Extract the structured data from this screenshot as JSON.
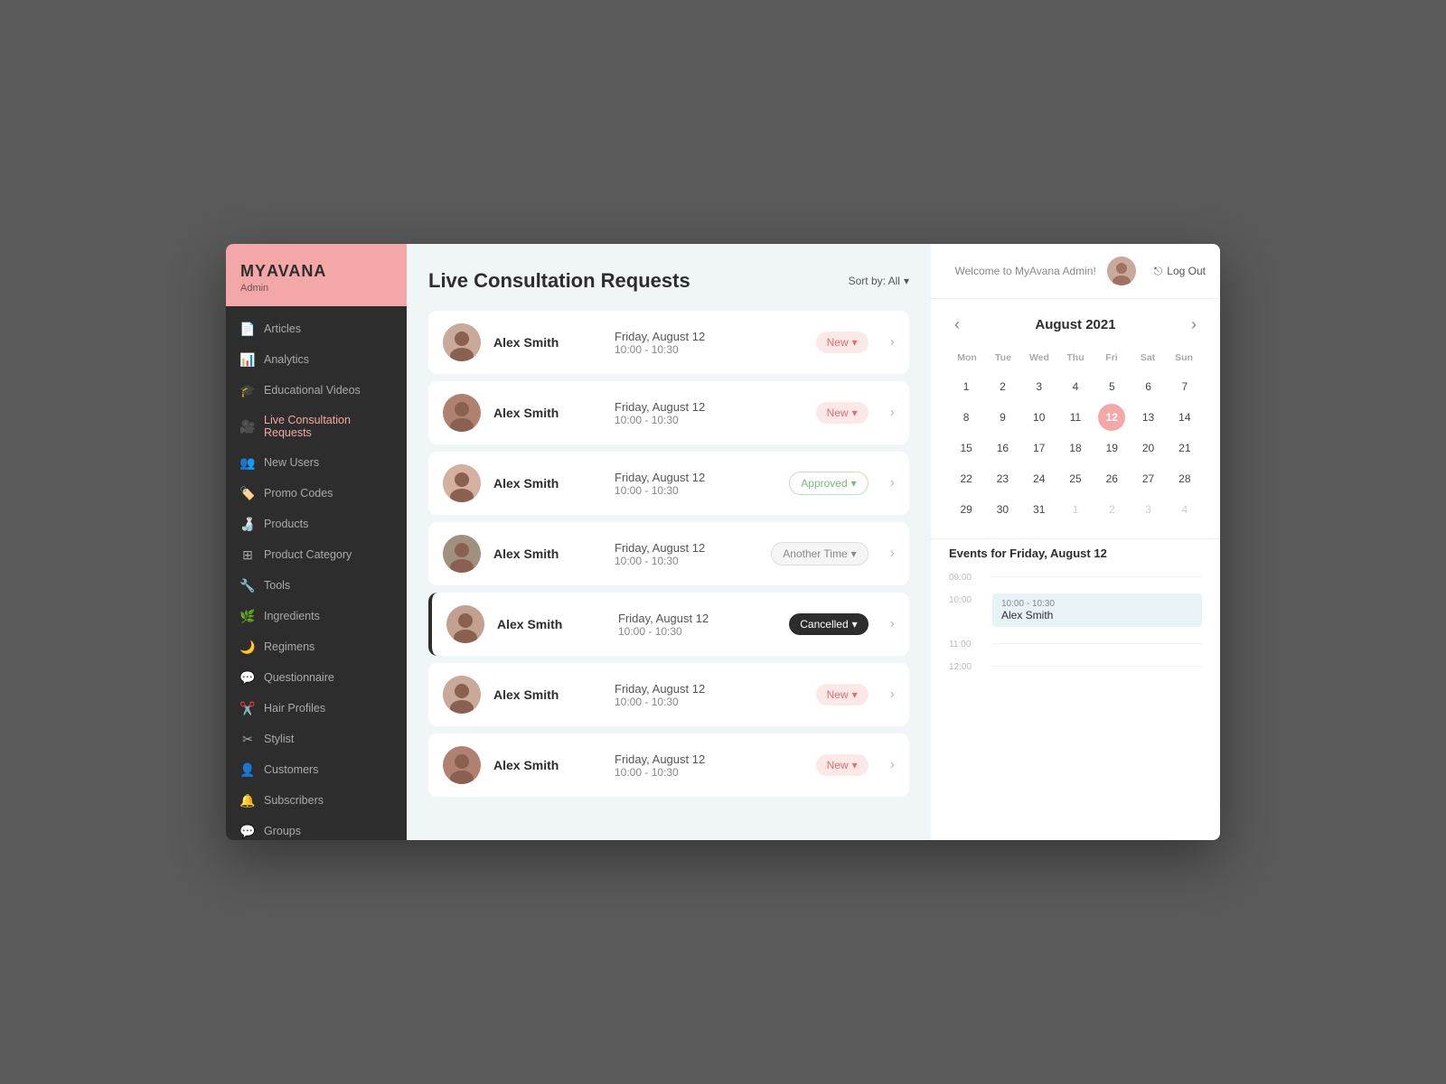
{
  "sidebar": {
    "logo": "MYAVANA",
    "logo_my": "MY",
    "logo_avana": "AVANA",
    "admin_label": "Admin",
    "nav_items": [
      {
        "id": "articles",
        "label": "Articles",
        "icon": "📄",
        "active": false
      },
      {
        "id": "analytics",
        "label": "Analytics",
        "icon": "📊",
        "active": false
      },
      {
        "id": "educational_videos",
        "label": "Educational Videos",
        "icon": "🎓",
        "active": false
      },
      {
        "id": "live_consultation",
        "label": "Live Consultation Requests",
        "icon": "🎥",
        "active": true
      },
      {
        "id": "new_users",
        "label": "New Users",
        "icon": "👥",
        "active": false
      },
      {
        "id": "promo_codes",
        "label": "Promo Codes",
        "icon": "🏷️",
        "active": false
      },
      {
        "id": "products",
        "label": "Products",
        "icon": "🍶",
        "active": false
      },
      {
        "id": "product_category",
        "label": "Product Category",
        "icon": "⊞",
        "active": false
      },
      {
        "id": "tools",
        "label": "Tools",
        "icon": "🔧",
        "active": false
      },
      {
        "id": "ingredients",
        "label": "Ingredients",
        "icon": "🌿",
        "active": false
      },
      {
        "id": "regimens",
        "label": "Regimens",
        "icon": "🌙",
        "active": false
      },
      {
        "id": "questionnaire",
        "label": "Questionnaire",
        "icon": "💬",
        "active": false
      },
      {
        "id": "hair_profiles",
        "label": "Hair Profiles",
        "icon": "✂️",
        "active": false
      },
      {
        "id": "stylist",
        "label": "Stylist",
        "icon": "✂",
        "active": false
      },
      {
        "id": "customers",
        "label": "Customers",
        "icon": "👤",
        "active": false
      },
      {
        "id": "subscribers",
        "label": "Subscribers",
        "icon": "🔔",
        "active": false
      },
      {
        "id": "groups",
        "label": "Groups",
        "icon": "💬",
        "active": false
      }
    ]
  },
  "main": {
    "page_title": "Live Consultation Requests",
    "sort_label": "Sort by: All",
    "consultations": [
      {
        "id": 1,
        "name": "Alex Smith",
        "date": "Friday, August 12",
        "time": "10:00 - 10:30",
        "status": "New",
        "status_type": "new",
        "cancelled": false
      },
      {
        "id": 2,
        "name": "Alex Smith",
        "date": "Friday, August 12",
        "time": "10:00 - 10:30",
        "status": "New",
        "status_type": "new",
        "cancelled": false
      },
      {
        "id": 3,
        "name": "Alex Smith",
        "date": "Friday, August 12",
        "time": "10:00 - 10:30",
        "status": "Approved",
        "status_type": "approved",
        "cancelled": false
      },
      {
        "id": 4,
        "name": "Alex Smith",
        "date": "Friday, August 12",
        "time": "10:00 - 10:30",
        "status": "Another Time",
        "status_type": "another-time",
        "cancelled": false
      },
      {
        "id": 5,
        "name": "Alex Smith",
        "date": "Friday, August 12",
        "time": "10:00 - 10:30",
        "status": "Cancelled",
        "status_type": "cancelled",
        "cancelled": true
      },
      {
        "id": 6,
        "name": "Alex Smith",
        "date": "Friday, August 12",
        "time": "10:00 - 10:30",
        "status": "New",
        "status_type": "new",
        "cancelled": false
      },
      {
        "id": 7,
        "name": "Alex Smith",
        "date": "Friday, August 12",
        "time": "10:00 - 10:30",
        "status": "New",
        "status_type": "new",
        "cancelled": false
      }
    ]
  },
  "right_panel": {
    "welcome_text": "Welcome to MyAvana Admin!",
    "logout_label": "Log Out",
    "calendar": {
      "title": "August 2021",
      "month": "August 2021",
      "day_headers": [
        "Mon",
        "Tue",
        "Wed",
        "Thu",
        "Fri",
        "Sat",
        "Sun"
      ],
      "weeks": [
        [
          {
            "day": "",
            "other": true
          },
          {
            "day": "",
            "other": true
          },
          {
            "day": "",
            "other": true
          },
          {
            "day": "",
            "other": true
          },
          {
            "day": "",
            "other": true
          },
          {
            "day": "",
            "other": true
          },
          {
            "day": "",
            "other": true
          }
        ]
      ],
      "today": 12,
      "days": [
        {
          "d": 1
        },
        {
          "d": 2
        },
        {
          "d": 3
        },
        {
          "d": 4
        },
        {
          "d": 5
        },
        {
          "d": 6
        },
        {
          "d": 7
        },
        {
          "d": 8
        },
        {
          "d": 9
        },
        {
          "d": 10
        },
        {
          "d": 11
        },
        {
          "d": 12,
          "today": true
        },
        {
          "d": 13
        },
        {
          "d": 14
        },
        {
          "d": 15
        },
        {
          "d": 16
        },
        {
          "d": 17
        },
        {
          "d": 18
        },
        {
          "d": 19
        },
        {
          "d": 20
        },
        {
          "d": 21
        },
        {
          "d": 22
        },
        {
          "d": 23
        },
        {
          "d": 24
        },
        {
          "d": 25
        },
        {
          "d": 26
        },
        {
          "d": 27
        },
        {
          "d": 28
        },
        {
          "d": 29
        },
        {
          "d": 30
        },
        {
          "d": 31
        },
        {
          "d": "1",
          "other": true
        },
        {
          "d": "2",
          "other": true
        },
        {
          "d": "3",
          "other": true
        },
        {
          "d": "4",
          "other": true
        }
      ]
    },
    "events": {
      "title": "Events for Friday, August 12",
      "time_slots": [
        {
          "time": "09:00",
          "event": null
        },
        {
          "time": "10:00",
          "event": {
            "time_range": "10:00 - 10:30",
            "name": "Alex Smith"
          }
        },
        {
          "time": "11:00",
          "event": null
        },
        {
          "time": "12:00",
          "event": null
        }
      ]
    }
  }
}
